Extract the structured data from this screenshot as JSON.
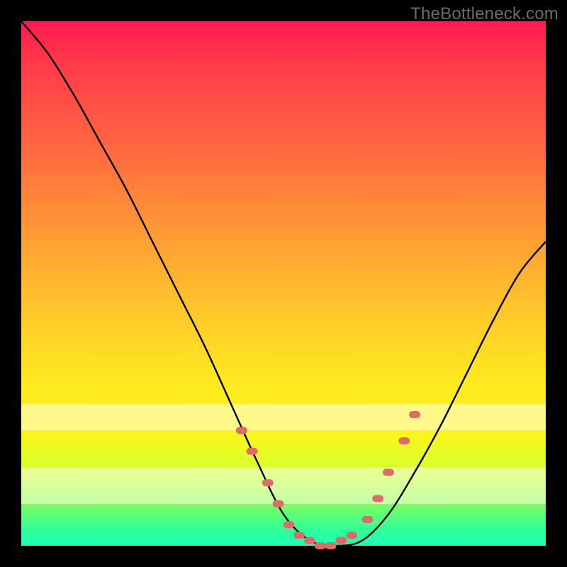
{
  "watermark": "TheBottleneck.com",
  "chart_data": {
    "type": "line",
    "title": "",
    "xlabel": "",
    "ylabel": "",
    "xlim": [
      0,
      100
    ],
    "ylim": [
      0,
      100
    ],
    "series": [
      {
        "name": "bottleneck-curve",
        "x": [
          0,
          5,
          10,
          15,
          20,
          25,
          30,
          35,
          40,
          45,
          50,
          55,
          60,
          65,
          70,
          75,
          80,
          85,
          90,
          95,
          100
        ],
        "y": [
          100,
          94,
          86,
          77,
          68,
          58,
          48,
          38,
          27,
          16,
          6,
          1,
          0,
          1,
          6,
          14,
          23,
          33,
          43,
          52,
          58
        ]
      }
    ],
    "markers": {
      "name": "highlighted-points",
      "color": "#e06a6a",
      "x": [
        42,
        44,
        47,
        49,
        51,
        53,
        55,
        57,
        59,
        61,
        63,
        66,
        68,
        70,
        73,
        75
      ],
      "y": [
        22,
        18,
        12,
        8,
        4,
        2,
        1,
        0,
        0,
        1,
        2,
        5,
        9,
        14,
        20,
        25
      ]
    },
    "bands": [
      {
        "name": "pale-band-upper",
        "y_from": 22,
        "y_to": 27
      },
      {
        "name": "pale-band-lower",
        "y_from": 8,
        "y_to": 15
      }
    ],
    "grid": false,
    "legend": false
  }
}
